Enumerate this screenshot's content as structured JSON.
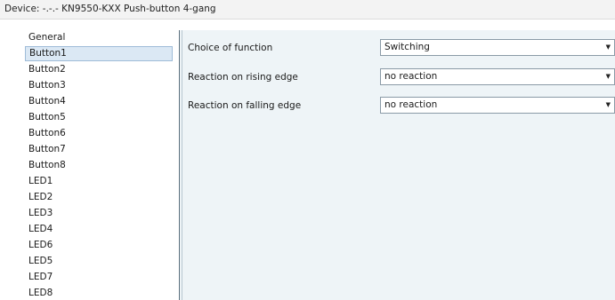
{
  "window": {
    "title": "Device: -.-.-  KN9550-KXX Push-button 4-gang"
  },
  "sidebar": {
    "items": [
      {
        "label": "General",
        "selected": false
      },
      {
        "label": "Button1",
        "selected": true
      },
      {
        "label": "Button2",
        "selected": false
      },
      {
        "label": "Button3",
        "selected": false
      },
      {
        "label": "Button4",
        "selected": false
      },
      {
        "label": "Button5",
        "selected": false
      },
      {
        "label": "Button6",
        "selected": false
      },
      {
        "label": "Button7",
        "selected": false
      },
      {
        "label": "Button8",
        "selected": false
      },
      {
        "label": "LED1",
        "selected": false
      },
      {
        "label": "LED2",
        "selected": false
      },
      {
        "label": "LED3",
        "selected": false
      },
      {
        "label": "LED4",
        "selected": false
      },
      {
        "label": "LED6",
        "selected": false
      },
      {
        "label": "LED5",
        "selected": false
      },
      {
        "label": "LED7",
        "selected": false
      },
      {
        "label": "LED8",
        "selected": false
      }
    ]
  },
  "params": [
    {
      "label": "Choice of function",
      "value": "Switching"
    },
    {
      "label": "Reaction on rising edge",
      "value": "no reaction"
    },
    {
      "label": "Reaction on falling edge",
      "value": "no reaction"
    }
  ],
  "icons": {
    "dropdown_arrow": "chevron-down-icon"
  },
  "colors": {
    "content_background": "#eef4f7",
    "selection_background": "#dbe8f4",
    "selection_border": "#9fbcd8"
  }
}
